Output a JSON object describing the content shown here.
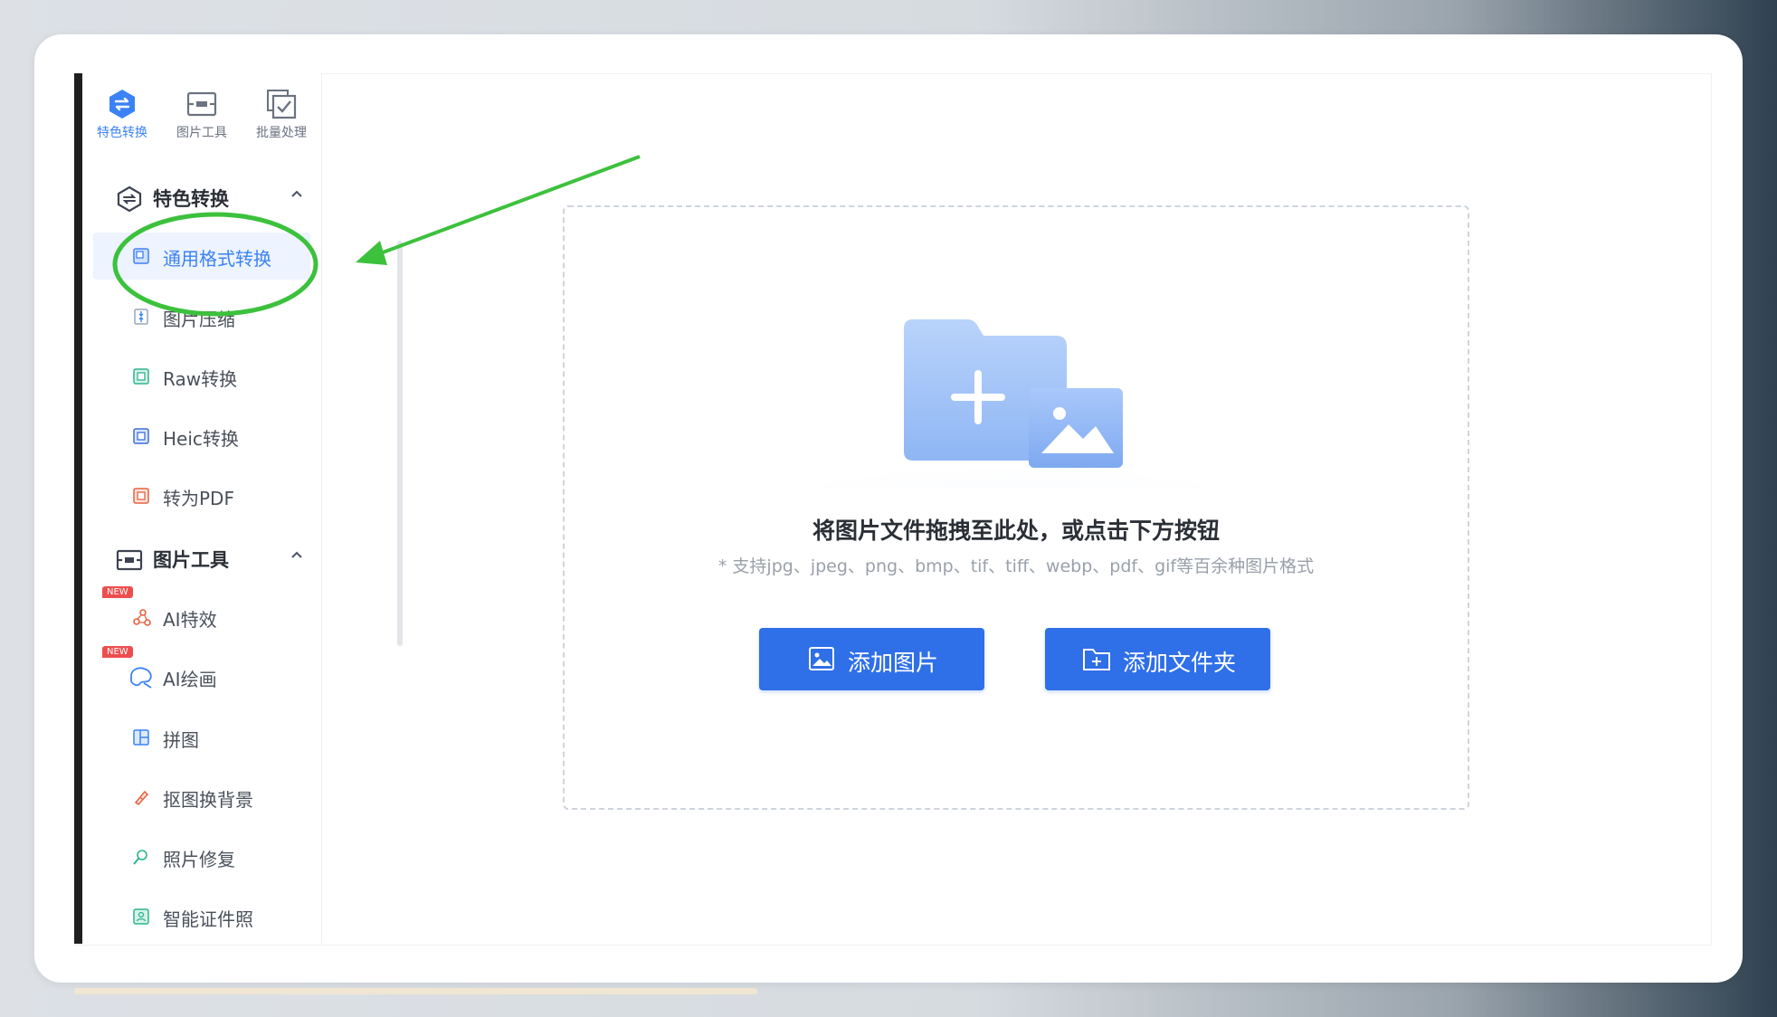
{
  "sidebar": {
    "tabs": [
      {
        "label": "特色转换",
        "icon": "feature-convert-icon",
        "active": true
      },
      {
        "label": "图片工具",
        "icon": "image-tools-icon",
        "active": false
      },
      {
        "label": "批量处理",
        "icon": "batch-process-icon",
        "active": false
      }
    ],
    "groups": [
      {
        "title": "特色转换",
        "icon": "feature-convert-icon",
        "collapse_glyph": "^",
        "items": [
          {
            "label": "通用格式转换",
            "icon": "format-convert-icon",
            "active": true
          },
          {
            "label": "图片压缩",
            "icon": "compress-icon"
          },
          {
            "label": "Raw转换",
            "icon": "raw-icon"
          },
          {
            "label": "Heic转换",
            "icon": "heic-icon"
          },
          {
            "label": "转为PDF",
            "icon": "pdf-icon"
          }
        ]
      },
      {
        "title": "图片工具",
        "icon": "image-tools-icon",
        "collapse_glyph": "^",
        "items": [
          {
            "label": "AI特效",
            "icon": "ai-effect-icon",
            "badge": "NEW"
          },
          {
            "label": "AI绘画",
            "icon": "ai-paint-icon",
            "badge": "NEW"
          },
          {
            "label": "拼图",
            "icon": "collage-icon"
          },
          {
            "label": "抠图换背景",
            "icon": "cutout-icon"
          },
          {
            "label": "照片修复",
            "icon": "photo-repair-icon"
          },
          {
            "label": "智能证件照",
            "icon": "id-photo-icon"
          }
        ]
      }
    ]
  },
  "dropzone": {
    "title": "将图片文件拖拽至此处，或点击下方按钮",
    "subtitle": "* 支持jpg、jpeg、png、bmp、tif、tiff、webp、pdf、gif等百余种图片格式",
    "add_image_label": "添加图片",
    "add_folder_label": "添加文件夹"
  },
  "colors": {
    "accent": "#3b82f6",
    "button": "#2f6fe8",
    "annotation": "#3cc13c",
    "badge": "#ee4d4d"
  }
}
